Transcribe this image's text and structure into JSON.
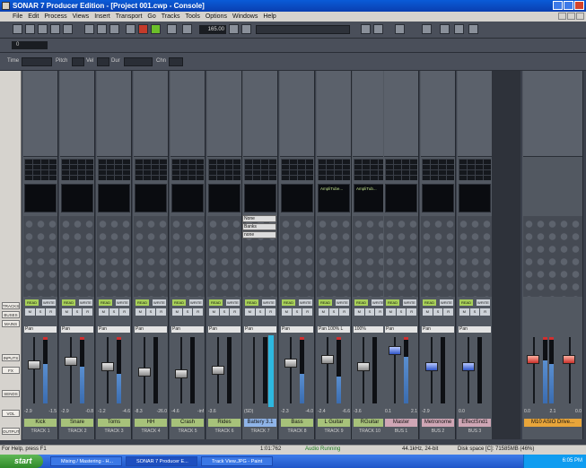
{
  "window": {
    "title": "SONAR 7 Producer Edition - [Project 001.cwp - Console]"
  },
  "menu": [
    "File",
    "Edit",
    "Process",
    "Views",
    "Insert",
    "Transport",
    "Go",
    "Tracks",
    "Tools",
    "Options",
    "Windows",
    "Help"
  ],
  "toolbar": {
    "tempo": "165.00",
    "counter": "0"
  },
  "event_bar": {
    "time": "Time",
    "pitch": "Pitch",
    "vel": "Vel",
    "dur": "Dur",
    "chn": "Chn"
  },
  "left_buttons": [
    "TRACKS",
    "BUSES",
    "MAINS",
    "INPUTS",
    "FX",
    "SENDS",
    "VOL",
    "OUTPUT"
  ],
  "dropdown": [
    "None",
    "Banks",
    "none"
  ],
  "strips": [
    {
      "name": "Kick",
      "num": "TRACK 1",
      "vals": [
        "-2.9",
        "-1.5"
      ],
      "pan": "Pan",
      "fx": ""
    },
    {
      "name": "Snare",
      "num": "TRACK 2",
      "vals": [
        "-2.9",
        "-0.8"
      ],
      "pan": "Pan",
      "fx": ""
    },
    {
      "name": "Toms",
      "num": "TRACK 3",
      "vals": [
        "-1.2",
        "-4.6"
      ],
      "pan": "Pan",
      "fx": ""
    },
    {
      "name": "HH",
      "num": "TRACK 4",
      "vals": [
        "-8.3",
        "-26.0"
      ],
      "pan": "Pan",
      "fx": ""
    },
    {
      "name": "Crash",
      "num": "TRACK 5",
      "vals": [
        "-4.6",
        "-inf"
      ],
      "pan": "Pan",
      "fx": ""
    },
    {
      "name": "Rides",
      "num": "TRACK 6",
      "vals": [
        "-3.6",
        ""
      ],
      "pan": "Pan",
      "fx": ""
    },
    {
      "name": "Battery 3.1",
      "num": "TRACK 7",
      "vals": [
        "(SD)",
        ""
      ],
      "pan": "Pan",
      "fx": ""
    },
    {
      "name": "Bass",
      "num": "TRACK 8",
      "vals": [
        "-2.3",
        "-4.0"
      ],
      "pan": "Pan",
      "fx": ""
    },
    {
      "name": "L Guitar",
      "num": "TRACK 9",
      "vals": [
        "-2.4",
        "-6.6"
      ],
      "pan": "Pan 100% L",
      "fx": "AmpliTube..."
    },
    {
      "name": "RGuitar",
      "num": "TRACK 10",
      "vals": [
        "-3.6",
        ""
      ],
      "pan": "100%",
      "fx": "AmpliTub..."
    },
    {
      "name": "Master",
      "num": "BUS 1",
      "vals": [
        "0.1",
        "2.1"
      ],
      "pan": "Pan",
      "fx": ""
    },
    {
      "name": "Metronome",
      "num": "BUS 2",
      "vals": [
        "-2.9",
        ""
      ],
      "pan": "Pan",
      "fx": ""
    },
    {
      "name": "EffectSnd1",
      "num": "BUS 3",
      "vals": [
        "0.0",
        ""
      ],
      "pan": "Pan",
      "fx": ""
    }
  ],
  "out_strip": {
    "name": "M10 ASIO Drive...",
    "num": "",
    "vals": [
      "0.0",
      "2.1",
      "0.0"
    ]
  },
  "rw": {
    "read": "READ",
    "write": "WRITE"
  },
  "msr": [
    "M",
    "S",
    "R"
  ],
  "status": {
    "help": "For Help, press F1",
    "time": "1:01:762",
    "audio": "Audio Running",
    "format": "44.1kHz, 24-bit",
    "disk": "Disk space [C]: 71585MB (46%)"
  },
  "taskbar": {
    "start": "start",
    "tasks": [
      "Mixing / Mastering - H...",
      "SONAR 7 Producer E...",
      "Track View.JPG - Paint"
    ],
    "clock": "6:05 PM"
  }
}
